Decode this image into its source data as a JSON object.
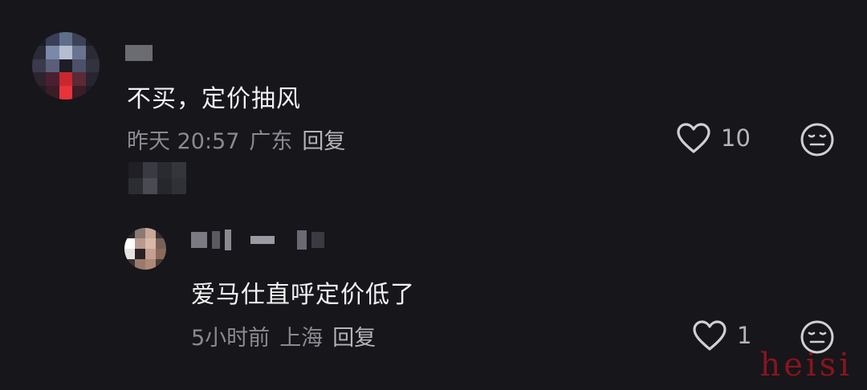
{
  "comment": {
    "text": "不买，定价抽风",
    "time": "昨天 20:57",
    "location": "广东",
    "reply_label": "回复",
    "likes": "10",
    "avatar_icon": "pixelated-avatar",
    "like_icon": "heart-outline-icon",
    "emoji_icon": "meh-face-icon"
  },
  "reply": {
    "text": "爱马仕直呼定价低了",
    "time": "5小时前",
    "location": "上海",
    "reply_label": "回复",
    "likes": "1",
    "avatar_icon": "pixelated-avatar",
    "like_icon": "heart-outline-icon",
    "emoji_icon": "meh-face-icon"
  },
  "watermark": "heisi",
  "colors": {
    "background": "#16161b",
    "text_primary": "#f2f2f4",
    "text_secondary": "#8a8a92",
    "icon": "#cfcfd4",
    "watermark": "#aa141c"
  }
}
